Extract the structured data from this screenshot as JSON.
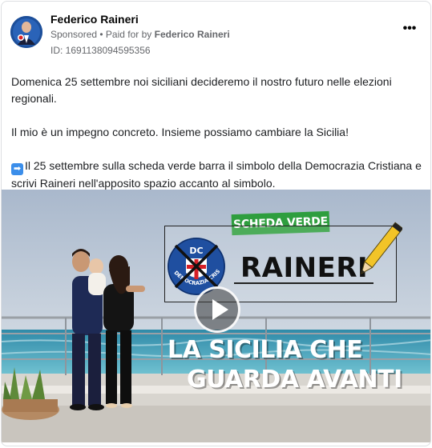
{
  "post": {
    "author": "Federico Raineri",
    "sponsored": "Sponsored",
    "separator": " • ",
    "paid_for_prefix": "Paid for by ",
    "paid_for_by": "Federico Raineri",
    "ad_id": "ID: 1691138094595356",
    "more_label": "•••"
  },
  "body": {
    "p1": "Domenica 25 settembre noi siciliani decideremo il nostro futuro nelle elezioni regionali.",
    "p2": "Il mio è un impegno concreto. Insieme possiamo cambiare la Sicilia!",
    "p3_emoji": "➡",
    "p3": "Il 25 settembre sulla scheda verde barra il simbolo della Democrazia Cristiana e scrivi Raineri nell'apposito spazio accanto al simbolo."
  },
  "video": {
    "badge": "SCHEDA VERDE",
    "logo_top": "DC",
    "logo_ring": "DEMOCRAZIA CRISTIANA",
    "candidate": "RAINERI",
    "slogan_line1": "LA SICILIA CHE",
    "slogan_line2": "GUARDA AVANTI"
  },
  "colors": {
    "badge_green": "#2e9e3e",
    "logo_blue": "#1f4fa0",
    "sea": "#3f9cb6",
    "sky": "#b8c8da"
  },
  "icons": {
    "more": "more-horizontal-icon",
    "play": "play-icon",
    "arrow": "right-arrow-emoji-icon"
  }
}
